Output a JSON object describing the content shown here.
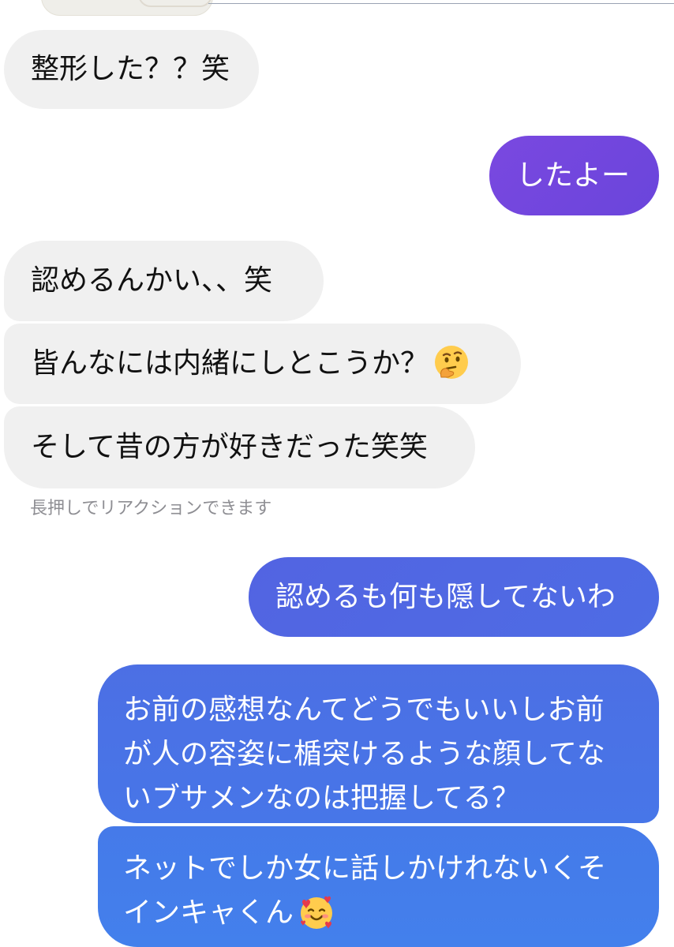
{
  "conversation": {
    "messages": [
      {
        "side": "left",
        "text": "整形した？？笑"
      },
      {
        "side": "right",
        "text": "したよー"
      },
      {
        "side": "left",
        "text": "認めるんかい、、笑"
      },
      {
        "side": "left",
        "text": "皆んなには内緒にしとこうか？",
        "emoji": "thinking-face"
      },
      {
        "side": "left",
        "text": "そして昔の方が好きだった笑笑"
      },
      {
        "side": "right",
        "text": "認めるも何も隠してないわ"
      },
      {
        "side": "right",
        "lines": [
          "お前の感想なんてどうでもいいしお前",
          "が人の容姿に楯突けるような顔してな",
          "いブサメンなのは把握してる？"
        ]
      },
      {
        "side": "right",
        "lines": [
          "ネットでしか女に話しかけれないくそ",
          "インキャくん"
        ],
        "emoji": "smiling-face-with-hearts"
      }
    ],
    "reaction_hint": "長押しでリアクションできます"
  },
  "colors": {
    "received_bubble": "#f0f0f0",
    "sent_gradient_top": "#7a48e0",
    "sent_gradient_bottom": "#4380ec",
    "hint_text": "#8e8e93"
  }
}
